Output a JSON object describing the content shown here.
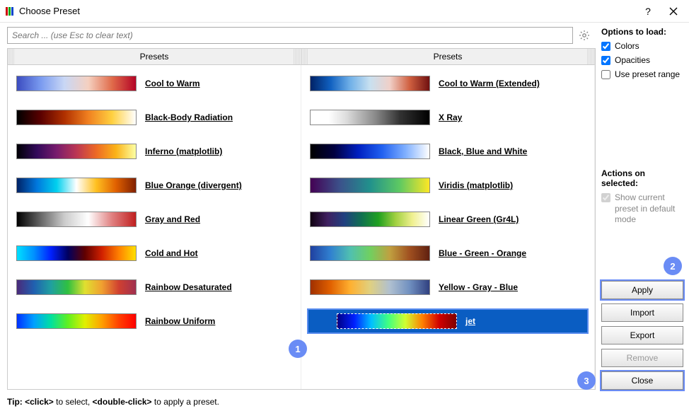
{
  "window": {
    "title": "Choose Preset"
  },
  "search": {
    "placeholder": "Search ... (use Esc to clear text)"
  },
  "grid": {
    "header_left": "Presets",
    "header_right": "Presets"
  },
  "presets_left": [
    {
      "label": "Cool to Warm",
      "gradient": "g-coolwarm"
    },
    {
      "label": "Black-Body Radiation",
      "gradient": "g-blackbody"
    },
    {
      "label": "Inferno (matplotlib)",
      "gradient": "g-inferno"
    },
    {
      "label": "Blue Orange (divergent)",
      "gradient": "g-blueorange"
    },
    {
      "label": "Gray and Red",
      "gradient": "g-grayred"
    },
    {
      "label": "Cold and Hot",
      "gradient": "g-coldhot"
    },
    {
      "label": "Rainbow Desaturated",
      "gradient": "g-rainbowdesat"
    },
    {
      "label": "Rainbow Uniform",
      "gradient": "g-rainbowuni"
    }
  ],
  "presets_right": [
    {
      "label": "Cool to Warm (Extended)",
      "gradient": "g-coolwarmext"
    },
    {
      "label": "X Ray",
      "gradient": "g-xray"
    },
    {
      "label": "Black, Blue and White",
      "gradient": "g-bluewhite"
    },
    {
      "label": "Viridis (matplotlib)",
      "gradient": "g-viridis"
    },
    {
      "label": "Linear Green (Gr4L)",
      "gradient": "g-lingreen"
    },
    {
      "label": "Blue - Green - Orange",
      "gradient": "g-bgo"
    },
    {
      "label": "Yellow - Gray - Blue",
      "gradient": "g-ygb"
    },
    {
      "label": "jet",
      "gradient": "g-jet",
      "selected": true
    }
  ],
  "options": {
    "title": "Options to load:",
    "colors": {
      "label": "Colors",
      "checked": true
    },
    "opacities": {
      "label": "Opacities",
      "checked": true
    },
    "preset_range": {
      "label": "Use preset range",
      "checked": false
    }
  },
  "actions": {
    "title": "Actions on selected:",
    "show_default": {
      "label": "Show current preset in default mode",
      "checked": true
    }
  },
  "buttons": {
    "apply": "Apply",
    "import": "Import",
    "export": "Export",
    "remove": "Remove",
    "close": "Close"
  },
  "annotations": {
    "b1": "1",
    "b2": "2",
    "b3": "3"
  },
  "footer": {
    "tip_prefix": "Tip: ",
    "click": "<click>",
    "mid1": " to select, ",
    "dclick": "<double-click>",
    "mid2": " to apply a preset."
  }
}
